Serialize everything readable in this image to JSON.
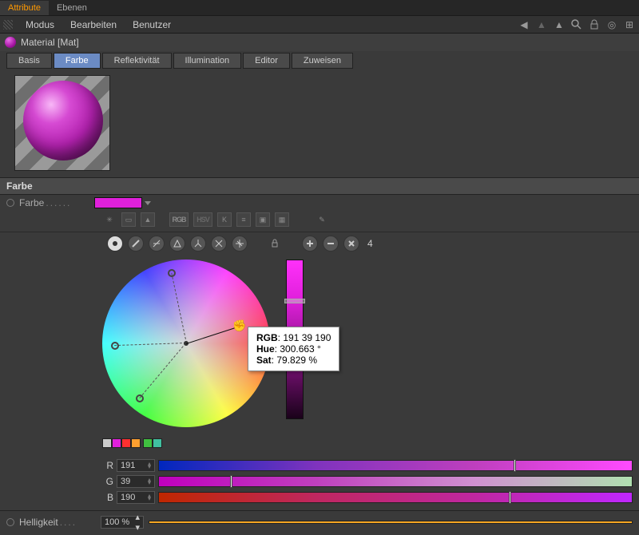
{
  "top_tabs": {
    "attribute": "Attribute",
    "ebenen": "Ebenen"
  },
  "menubar": {
    "modus": "Modus",
    "bearbeiten": "Bearbeiten",
    "benutzer": "Benutzer"
  },
  "material": {
    "name": "Material [Mat]"
  },
  "prop_tabs": {
    "basis": "Basis",
    "farbe": "Farbe",
    "reflekt": "Reflektivität",
    "illum": "Illumination",
    "editor": "Editor",
    "zuweisen": "Zuweisen"
  },
  "section": {
    "farbe": "Farbe"
  },
  "farbe_row": {
    "label": "   Farbe"
  },
  "iconbar": {
    "rgb": "RGB",
    "hsv": "HSV"
  },
  "zoom": {
    "count": "4"
  },
  "tooltip": {
    "rgb_label": "RGB",
    "rgb_value": "191 39 190",
    "hue_label": "Hue",
    "hue_value": "300.663 °",
    "sat_label": "Sat",
    "sat_value": "79.829 %"
  },
  "sliders": {
    "r": {
      "label": "R",
      "value": "191"
    },
    "g": {
      "label": "G",
      "value": "39"
    },
    "b": {
      "label": "B",
      "value": "190"
    }
  },
  "helligkeit": {
    "label": "   Helligkeit",
    "value": "100 %"
  },
  "colors": {
    "accent": "#e020db",
    "swatches": [
      "#cccccc",
      "#e020db",
      "#ff3030",
      "#ffa030",
      "#40c040",
      "#40c0a0"
    ]
  }
}
